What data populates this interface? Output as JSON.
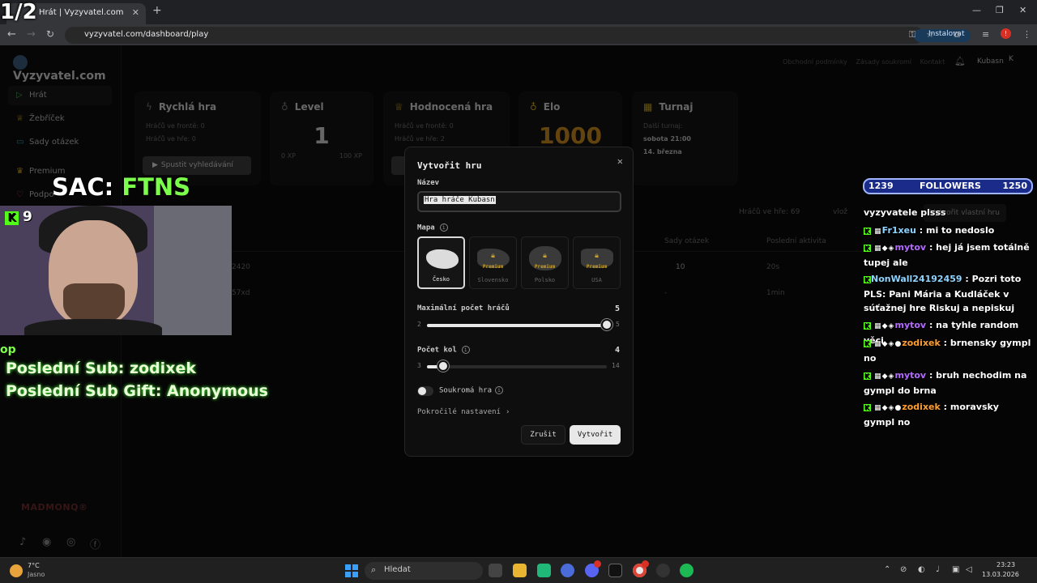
{
  "browser": {
    "tab_title": "Hrát | Vyzyvatel.com",
    "url": "vyzyvatel.com/dashboard/play",
    "install_label": "Instalovat",
    "profile_badge": "!"
  },
  "site": {
    "logo": "Vyzyvatel.com",
    "sidebar": {
      "items": [
        {
          "label": "Hrát",
          "icon": "play-icon"
        },
        {
          "label": "Žebříček",
          "icon": "trophy-icon"
        },
        {
          "label": "Sady otázek",
          "icon": "book-icon"
        },
        {
          "label": "Premium",
          "icon": "crown-icon"
        },
        {
          "label": "Podpo",
          "icon": "heart-icon"
        }
      ],
      "sponsor": "MADMONQ®"
    },
    "top_links": [
      "Obchodní podmínky",
      "Zásady soukromí",
      "Kontakt"
    ],
    "user": {
      "name": "Kubasn",
      "initial": "K"
    },
    "cards": {
      "quick": {
        "title": "Rychlá hra",
        "queue": "Hráčů ve frontě: 0",
        "in_game": "Hráčů ve hře: 0",
        "button": "Spustit vyhledávání"
      },
      "level": {
        "title": "Level",
        "value": "1",
        "xp_min": "0 XP",
        "xp_max": "100 XP"
      },
      "ranked": {
        "title": "Hodnocená hra",
        "queue": "Hráčů ve frontě: 0",
        "in_game": "Hráčů ve hře: 2"
      },
      "elo": {
        "title": "Elo",
        "value": "1000"
      },
      "tournament": {
        "title": "Turnaj",
        "next": "Další turnaj:",
        "time": "sobota 21:00",
        "date": "14. března"
      }
    },
    "games_section": {
      "players_in_game": "Hráčů ve hře: 69",
      "insert_placeholder": "vlož",
      "create_own": "Vytvořit vlastní hru",
      "col_sets": "Sady otázek",
      "col_activity": "Poslední aktivita",
      "rows": [
        {
          "name_tail": "2420",
          "sets": "10",
          "activity": "20s"
        },
        {
          "name_tail": "57xd",
          "sets": "-",
          "activity": "1min"
        }
      ]
    }
  },
  "modal": {
    "title": "Vytvořit hru",
    "name_label": "Název",
    "name_value": "Hra hráče Kubasn",
    "map_label": "Mapa",
    "maps": [
      {
        "name": "Česko",
        "premium": false,
        "selected": true
      },
      {
        "name": "Slovensko",
        "premium": true,
        "selected": false
      },
      {
        "name": "Polsko",
        "premium": true,
        "selected": false
      },
      {
        "name": "USA",
        "premium": true,
        "selected": false
      }
    ],
    "premium_tag": "Premium",
    "max_players": {
      "label": "Maximální počet hráčů",
      "value": 5,
      "min": 2,
      "max": 5
    },
    "rounds": {
      "label": "Počet kol",
      "value": 4,
      "min": 3,
      "max": 14
    },
    "private_label": "Soukromá hra",
    "private_enabled": false,
    "advanced_label": "Pokročilé nastavení",
    "cancel_label": "Zrušit",
    "create_label": "Vytvořit"
  },
  "overlay": {
    "page_counter": "1/2",
    "sac_prefix": "SAC: ",
    "sac_code": "FTNS",
    "kick_count": "9",
    "op_fragment": "op",
    "last_sub": "Poslední Sub: zodixek",
    "last_gift": "Poslední Sub Gift: Anonymous",
    "followers": {
      "current": "1239",
      "label": "FOLLOWERS",
      "goal": "1250"
    },
    "chat": [
      {
        "user": "",
        "text": "vyzyvatele plsss",
        "user_color": "#ffffff"
      },
      {
        "user": "Fr1xeu",
        "text": ": mi to nedoslo",
        "user_color": "#8fd3ff"
      },
      {
        "user": "mytov",
        "text": ": hej já jsem totálně tupej ale",
        "user_color": "#b36bff"
      },
      {
        "user": "NonWall24192459",
        "text": ": Pozri toto PLS: Pani Mária a Kudláček v súťažnej hre Riskuj a nepiskuj",
        "user_color": "#8fd3ff"
      },
      {
        "user": "mytov",
        "text": ": na tyhle random věci",
        "user_color": "#b36bff"
      },
      {
        "user": "zodixek",
        "text": ": brnensky gympl no",
        "user_color": "#ff9d2e"
      },
      {
        "user": "mytov",
        "text": ": bruh nechodim na gympl do brna",
        "user_color": "#b36bff"
      },
      {
        "user": "zodixek",
        "text": ": moravsky gympl no",
        "user_color": "#ff9d2e"
      }
    ]
  },
  "taskbar": {
    "temp": "7°C",
    "weather": "Jasno",
    "search_placeholder": "Hledat",
    "time": "23:23",
    "date": "13.03.2026"
  }
}
